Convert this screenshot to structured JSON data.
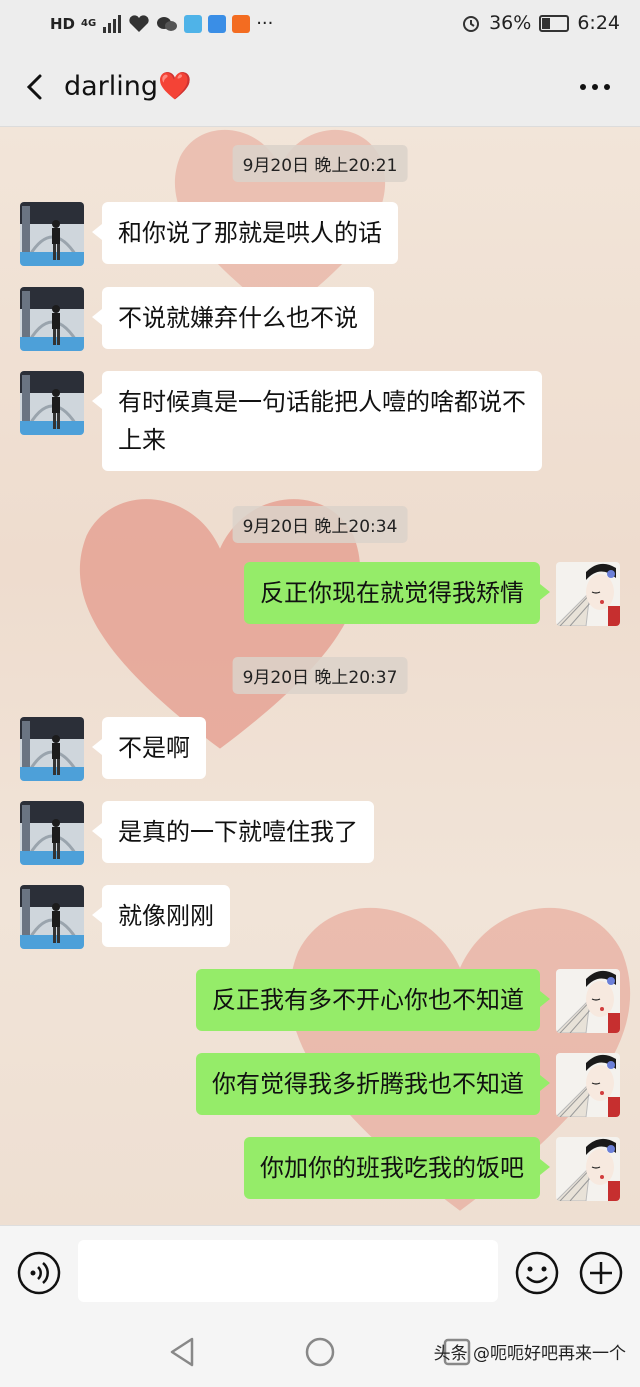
{
  "status_bar": {
    "hd": "HD",
    "network": "4G",
    "battery_text": "36%",
    "battery_level": 0.36,
    "time": "6:24",
    "more": "···"
  },
  "header": {
    "title": "darling❤️"
  },
  "messages": [
    {
      "kind": "time",
      "text": "9月20日 晚上20:21"
    },
    {
      "kind": "msg",
      "side": "left",
      "text": "和你说了那就是哄人的话"
    },
    {
      "kind": "msg",
      "side": "left",
      "text": "不说就嫌弃什么也不说"
    },
    {
      "kind": "msg",
      "side": "left",
      "text": "有时候真是一句话能把人噎的啥都说不上来"
    },
    {
      "kind": "time",
      "text": "9月20日 晚上20:34"
    },
    {
      "kind": "msg",
      "side": "right",
      "text": "反正你现在就觉得我矫情"
    },
    {
      "kind": "time",
      "text": "9月20日 晚上20:37"
    },
    {
      "kind": "msg",
      "side": "left",
      "text": "不是啊"
    },
    {
      "kind": "msg",
      "side": "left",
      "text": "是真的一下就噎住我了"
    },
    {
      "kind": "msg",
      "side": "left",
      "text": "就像刚刚"
    },
    {
      "kind": "msg",
      "side": "right",
      "text": "反正我有多不开心你也不知道"
    },
    {
      "kind": "msg",
      "side": "right",
      "text": "你有觉得我多折腾我也不知道"
    },
    {
      "kind": "msg",
      "side": "right",
      "text": "你加你的班我吃我的饭吧"
    }
  ],
  "input_bar": {
    "voice_icon": "voice-icon",
    "emoji_icon": "emoji-icon",
    "plus_icon": "plus-icon"
  },
  "watermark": "头条 @呃呃好吧再来一个",
  "colors": {
    "sent_bubble": "#95ec69",
    "received_bubble": "#ffffff",
    "chrome": "#ededed"
  }
}
